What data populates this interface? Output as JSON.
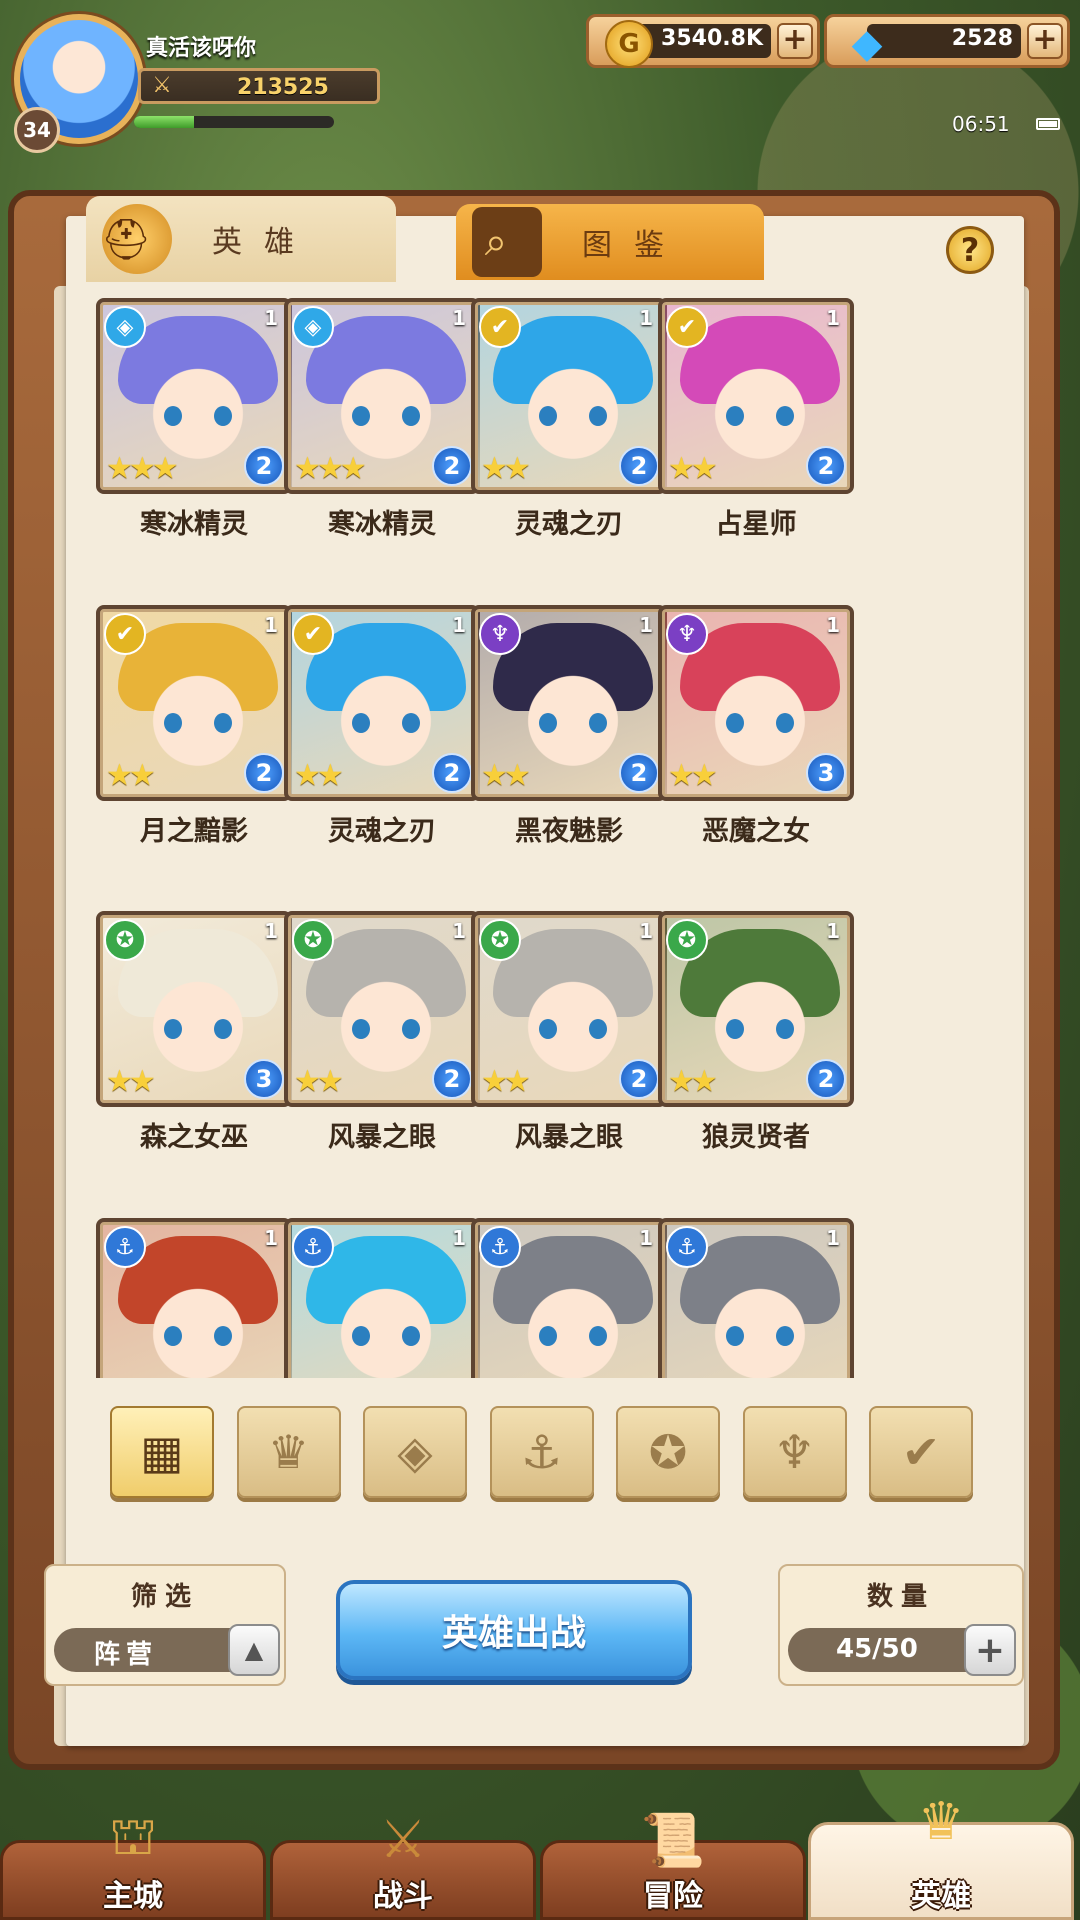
{
  "player": {
    "name": "真活该呀你",
    "level": "34",
    "power": "213525",
    "exp_fraction": 0.3
  },
  "currency": {
    "gold": "3540.8K",
    "gems": "2528",
    "plus": "+"
  },
  "status": {
    "time": "06:51"
  },
  "tabs": {
    "heroes": "英雄",
    "codex": "图鉴"
  },
  "help": "?",
  "heroes": [
    {
      "name": "寒冰精灵",
      "faction_glyph": "◈",
      "faction_color": "#2fa8e8",
      "hair": "#7c7ae0",
      "level": "1",
      "stars": "★★★",
      "rank": "2"
    },
    {
      "name": "寒冰精灵",
      "faction_glyph": "◈",
      "faction_color": "#2fa8e8",
      "hair": "#7c7ae0",
      "level": "1",
      "stars": "★★★",
      "rank": "2"
    },
    {
      "name": "灵魂之刃",
      "faction_glyph": "✔",
      "faction_color": "#e3b522",
      "hair": "#2ea6e8",
      "level": "1",
      "stars": "★★",
      "rank": "2"
    },
    {
      "name": "占星师",
      "faction_glyph": "✔",
      "faction_color": "#e3b522",
      "hair": "#d44ab8",
      "level": "1",
      "stars": "★★",
      "rank": "2"
    },
    {
      "name": "月之黯影",
      "faction_glyph": "✔",
      "faction_color": "#e3b522",
      "hair": "#e8b338",
      "level": "1",
      "stars": "★★",
      "rank": "2"
    },
    {
      "name": "灵魂之刃",
      "faction_glyph": "✔",
      "faction_color": "#e3b522",
      "hair": "#2ea6e8",
      "level": "1",
      "stars": "★★",
      "rank": "2"
    },
    {
      "name": "黑夜魅影",
      "faction_glyph": "♆",
      "faction_color": "#7b3fc4",
      "hair": "#2f2a4a",
      "level": "1",
      "stars": "★★",
      "rank": "2"
    },
    {
      "name": "恶魔之女",
      "faction_glyph": "♆",
      "faction_color": "#7b3fc4",
      "hair": "#d8425a",
      "level": "1",
      "stars": "★★",
      "rank": "3"
    },
    {
      "name": "森之女巫",
      "faction_glyph": "✪",
      "faction_color": "#3aa84a",
      "hair": "#efe9d8",
      "level": "1",
      "stars": "★★",
      "rank": "3"
    },
    {
      "name": "风暴之眼",
      "faction_glyph": "✪",
      "faction_color": "#3aa84a",
      "hair": "#b6b3ad",
      "level": "1",
      "stars": "★★",
      "rank": "2"
    },
    {
      "name": "风暴之眼",
      "faction_glyph": "✪",
      "faction_color": "#3aa84a",
      "hair": "#b6b3ad",
      "level": "1",
      "stars": "★★",
      "rank": "2"
    },
    {
      "name": "狼灵贤者",
      "faction_glyph": "✪",
      "faction_color": "#3aa84a",
      "hair": "#4e7a3a",
      "level": "1",
      "stars": "★★",
      "rank": "2"
    },
    {
      "name": "",
      "faction_glyph": "⚓",
      "faction_color": "#2f78d8",
      "hair": "#c2452a",
      "level": "1",
      "stars": "",
      "rank": ""
    },
    {
      "name": "",
      "faction_glyph": "⚓",
      "faction_color": "#2f78d8",
      "hair": "#2fb7e8",
      "level": "1",
      "stars": "",
      "rank": ""
    },
    {
      "name": "",
      "faction_glyph": "⚓",
      "faction_color": "#2f78d8",
      "hair": "#7d8088",
      "level": "1",
      "stars": "",
      "rank": ""
    },
    {
      "name": "",
      "faction_glyph": "⚓",
      "faction_color": "#2f78d8",
      "hair": "#7d8088",
      "level": "1",
      "stars": "",
      "rank": ""
    }
  ],
  "faction_filters": [
    {
      "glyph": "▦",
      "name": "all-filter-icon"
    },
    {
      "glyph": "♛",
      "name": "crown-filter-icon"
    },
    {
      "glyph": "◈",
      "name": "ice-filter-icon"
    },
    {
      "glyph": "⚓",
      "name": "anchor-filter-icon"
    },
    {
      "glyph": "✪",
      "name": "beast-filter-icon"
    },
    {
      "glyph": "♆",
      "name": "demon-filter-icon"
    },
    {
      "glyph": "✔",
      "name": "light-filter-icon"
    }
  ],
  "controls": {
    "filter_title": "筛选",
    "faction_value": "阵营",
    "deploy_label": "英雄出战",
    "count_title": "数量",
    "count_value": "45/50"
  },
  "nav": [
    {
      "label": "主城",
      "icon": "castle-icon",
      "glyph": "⛫"
    },
    {
      "label": "战斗",
      "icon": "crossed-swords-icon",
      "glyph": "⚔"
    },
    {
      "label": "冒险",
      "icon": "scroll-map-icon",
      "glyph": "📜"
    },
    {
      "label": "英雄",
      "icon": "hero-helmet-icon",
      "glyph": "♛"
    }
  ]
}
